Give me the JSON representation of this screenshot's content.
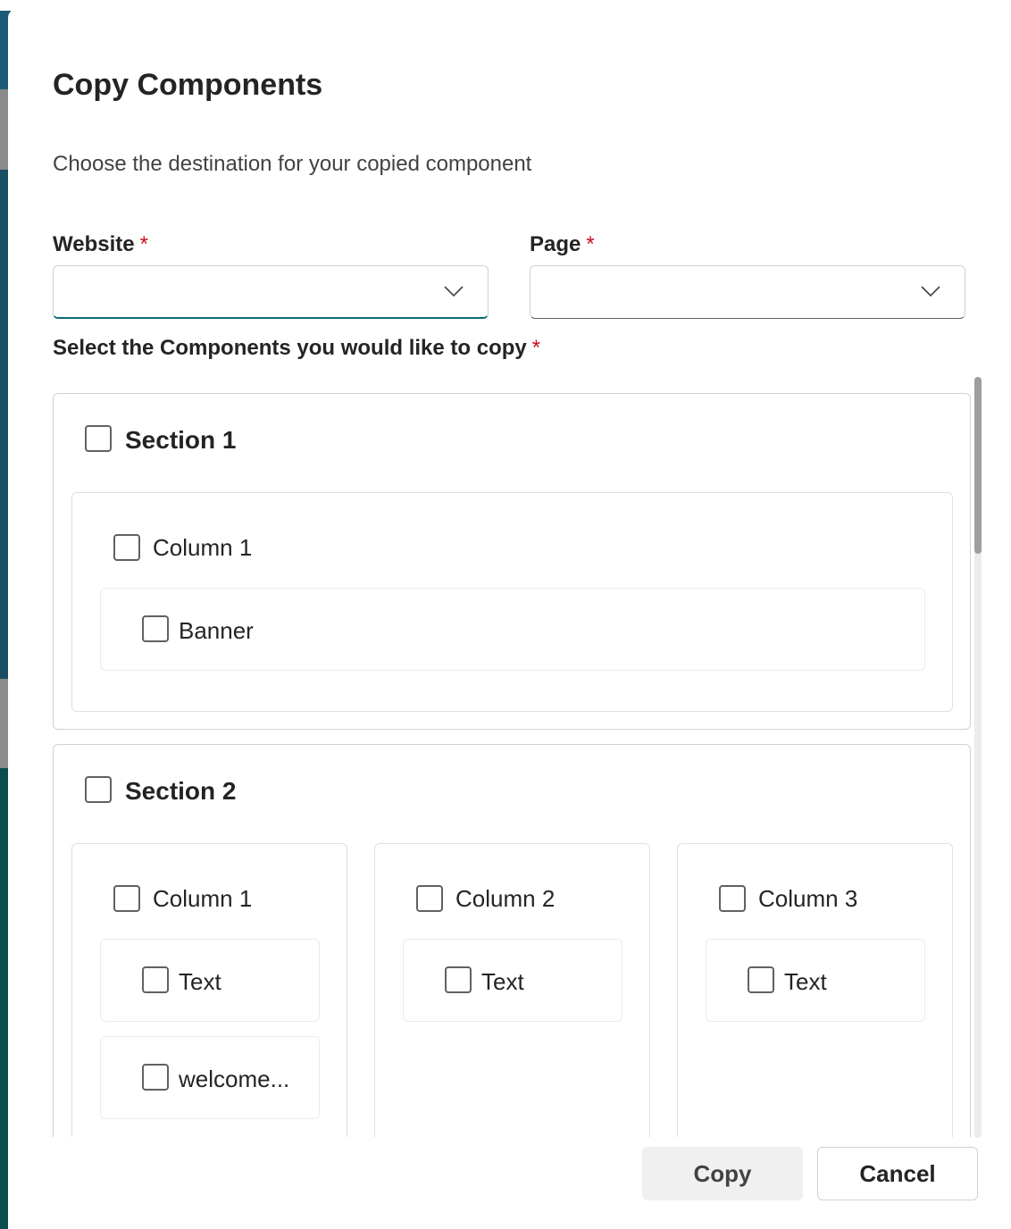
{
  "dialog": {
    "title": "Copy Components",
    "subtitle": "Choose the destination for your copied component"
  },
  "fields": {
    "website_label": "Website",
    "page_label": "Page",
    "required_mark": "*",
    "website_value": "",
    "page_value": ""
  },
  "components_label": "Select the Components you would like to copy",
  "sections": [
    {
      "title": "Section 1",
      "checked": false,
      "columns": [
        {
          "title": "Column 1",
          "checked": false,
          "components": [
            {
              "label": "Banner",
              "checked": false
            }
          ]
        }
      ]
    },
    {
      "title": "Section 2",
      "checked": false,
      "columns": [
        {
          "title": "Column 1",
          "checked": false,
          "components": [
            {
              "label": "Text",
              "checked": false
            },
            {
              "label": "welcome...",
              "checked": false
            }
          ]
        },
        {
          "title": "Column 2",
          "checked": false,
          "components": [
            {
              "label": "Text",
              "checked": false
            }
          ]
        },
        {
          "title": "Column 3",
          "checked": false,
          "components": [
            {
              "label": "Text",
              "checked": false
            }
          ]
        }
      ]
    }
  ],
  "buttons": {
    "copy": "Copy",
    "cancel": "Cancel"
  },
  "icons": {
    "dropdown": "chevron-down-icon"
  },
  "colors": {
    "focus_underline": "#0f6a78",
    "required": "#c50f1f"
  }
}
